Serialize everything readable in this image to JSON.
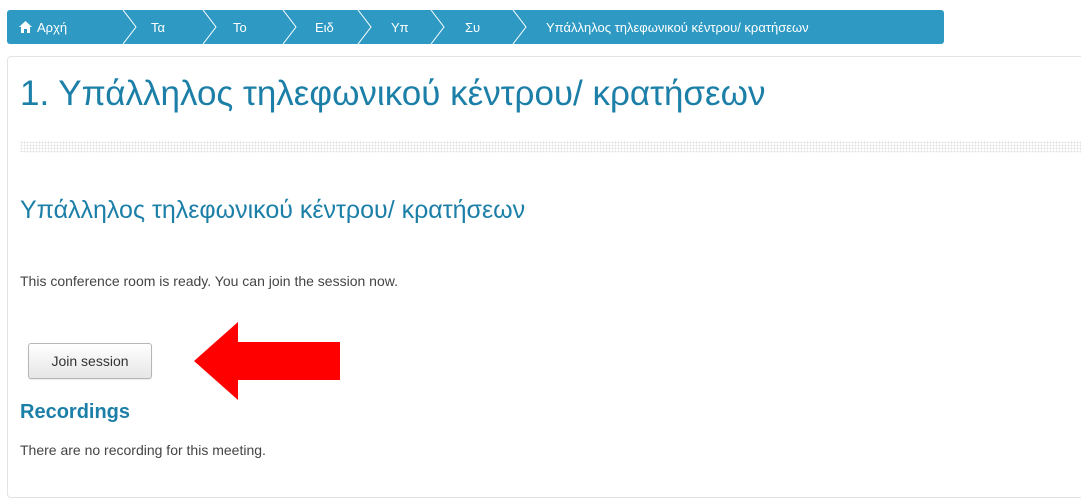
{
  "breadcrumb": {
    "items": [
      {
        "label": "Αρχή",
        "icon": "home-icon"
      },
      {
        "label": "Τα"
      },
      {
        "label": "Το"
      },
      {
        "label": "Ειδ"
      },
      {
        "label": "Υπ"
      },
      {
        "label": "Συ"
      },
      {
        "label": "Υπάλληλος τηλεφωνικού κέντρου/ κρατήσεων"
      }
    ],
    "color": "#2e9ac4"
  },
  "page": {
    "title": "1. Υπάλληλος τηλεφωνικού κέντρου/ κρατήσεων",
    "section_title": "Υπάλληλος τηλεφωνικού κέντρου/ κρατήσεων",
    "ready_message": "This conference room is ready. You can join the session now.",
    "join_button_label": "Join session",
    "recordings_title": "Recordings",
    "no_recordings_message": "There are no recording for this meeting."
  },
  "annotation": {
    "arrow_icon": "red-arrow-left-icon",
    "arrow_color": "#ff0000"
  },
  "colors": {
    "heading": "#1c7fa8",
    "body_text": "#444444"
  }
}
